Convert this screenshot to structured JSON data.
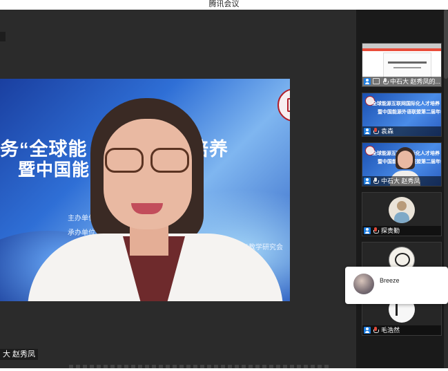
{
  "window": {
    "title": "腾讯会议"
  },
  "main_video": {
    "speaker_name": "大 赵秀凤",
    "slide": {
      "title_line1": "务“全球能    国际化人才培养",
      "title_line2": "暨中国能    第二届年会",
      "host_label": "主办单位：中",
      "organizer_label": "承办单位：上海",
      "org_line3": "世",
      "org_line4": "翻译与教学研究会"
    }
  },
  "participants": [
    {
      "name": "中石大 赵秀凤的...",
      "type": "screen-share",
      "mic": "on",
      "sharing": true
    },
    {
      "name": "袁森",
      "type": "blue-slide",
      "mic": "muted",
      "sharing": false
    },
    {
      "name": "中石大 赵秀凤",
      "type": "video",
      "mic": "on",
      "sharing": false
    },
    {
      "name": "探贵勤",
      "type": "avatar",
      "mic": "muted",
      "sharing": false
    },
    {
      "name": "",
      "type": "avatar-cartoon",
      "mic": "",
      "sharing": false
    },
    {
      "name": "毛浩然",
      "type": "avatar-calligraphy",
      "mic": "muted",
      "sharing": false
    }
  ],
  "popup": {
    "name": "Breeze"
  },
  "colors": {
    "accent_blue": "#1e7de0",
    "muted_red": "#e04a3a",
    "sidebar_bg": "#1a1a1a",
    "main_bg": "#2b2b2b"
  }
}
